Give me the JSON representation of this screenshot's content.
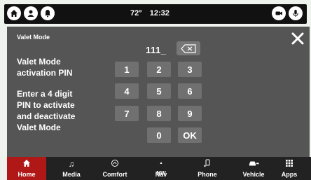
{
  "status": {
    "temperature": "72°",
    "time": "12:32"
  },
  "panel": {
    "title": "Valet Mode",
    "pin_label_line1": "Valet Mode",
    "pin_label_line2": "activation PIN",
    "instruction_lines": [
      "Enter a 4 digit",
      "PIN to activate",
      "and deactivate",
      "Valet Mode"
    ],
    "pin_value": "111_"
  },
  "keypad": {
    "keys": [
      "1",
      "2",
      "3",
      "4",
      "5",
      "6",
      "7",
      "8",
      "9",
      "0",
      "OK"
    ]
  },
  "nav": {
    "items": [
      {
        "label": "Home",
        "icon": "home-icon"
      },
      {
        "label": "Media",
        "icon": "music-note-icon"
      },
      {
        "label": "Comfort",
        "icon": "comfort-icon"
      },
      {
        "label": "Nav",
        "icon": "compass-icon"
      },
      {
        "label": "Phone",
        "icon": "phone-icon"
      },
      {
        "label": "Vehicle",
        "icon": "vehicle-icon"
      },
      {
        "label": "Apps",
        "icon": "apps-grid-icon"
      }
    ],
    "active": "Home",
    "accent": "#b01818"
  }
}
